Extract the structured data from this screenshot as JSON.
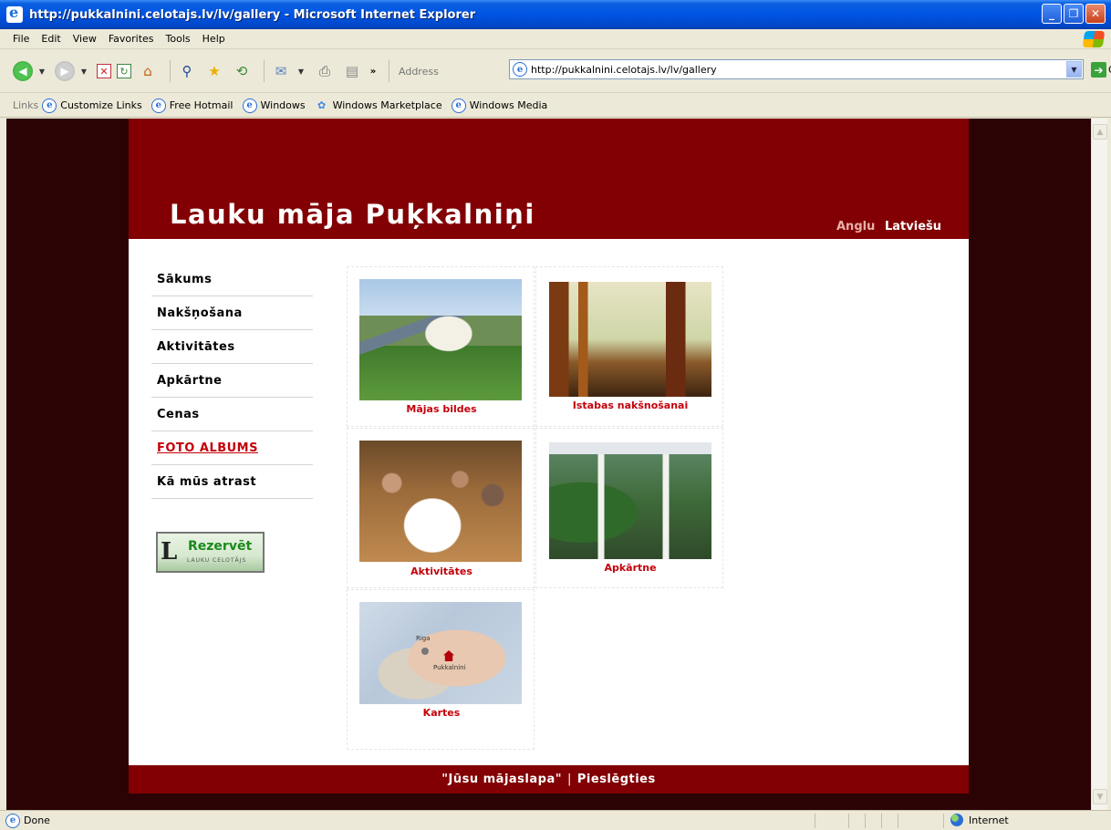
{
  "window": {
    "title": "http://pukkalnini.celotajs.lv/lv/gallery - Microsoft Internet Explorer"
  },
  "menu": [
    "File",
    "Edit",
    "View",
    "Favorites",
    "Tools",
    "Help"
  ],
  "toolbar": {
    "more": "»",
    "address_label": "Address",
    "url": "http://pukkalnini.celotajs.lv/lv/gallery",
    "go_label": "Go"
  },
  "links_bar": {
    "label": "Links",
    "items": [
      "Customize Links",
      "Free Hotmail",
      "Windows",
      "Windows Marketplace",
      "Windows Media"
    ]
  },
  "site": {
    "title": "Lauku māja Puķkalniņi",
    "lang_en": "Anglu",
    "lang_lv": "Latviešu",
    "nav": [
      {
        "label": "Sākums",
        "active": false
      },
      {
        "label": "Nakšņošana",
        "active": false
      },
      {
        "label": "Aktivitātes",
        "active": false
      },
      {
        "label": "Apkārtne",
        "active": false
      },
      {
        "label": "Cenas",
        "active": false
      },
      {
        "label": "FOTO ALBUMS",
        "active": true
      },
      {
        "label": "Kā mūs atrast",
        "active": false
      }
    ],
    "reserve_button": {
      "text": "Rezervēt",
      "subtext": "LAUKU CELOTĀJS"
    },
    "gallery": [
      {
        "caption": "Mājas bildes"
      },
      {
        "caption": "Istabas nakšnošanai"
      },
      {
        "caption": "Aktivitātes"
      },
      {
        "caption": "Apkārtne"
      },
      {
        "caption": "Kartes"
      }
    ],
    "map_labels": {
      "city": "Riga",
      "place": "Pukkalnini"
    },
    "footer": {
      "link1": "\"Jūsu mājaslapa\"",
      "separator": "|",
      "link2": "Pieslēgties"
    }
  },
  "status": {
    "text": "Done",
    "zone": "Internet"
  }
}
